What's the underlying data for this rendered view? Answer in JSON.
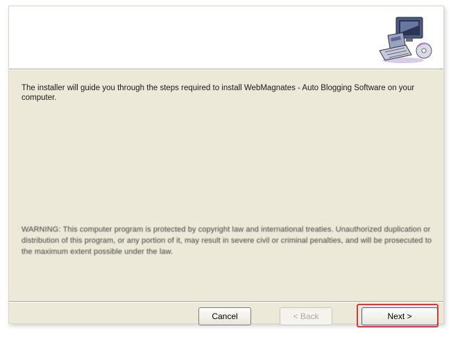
{
  "header": {
    "logo_icon": "computer-setup-icon"
  },
  "body": {
    "intro_text": "The installer will guide you through the steps required to install WebMagnates - Auto Blogging Software on your computer.",
    "warning_text": "WARNING: This computer program is protected by copyright law and international treaties. Unauthorized duplication or distribution of this program, or any portion of it, may result in severe civil or criminal penalties, and will be prosecuted to the maximum extent possible under the law."
  },
  "footer": {
    "cancel_label": "Cancel",
    "back_label": "< Back",
    "next_label": "Next >",
    "highlight_color": "#d23a3a"
  }
}
